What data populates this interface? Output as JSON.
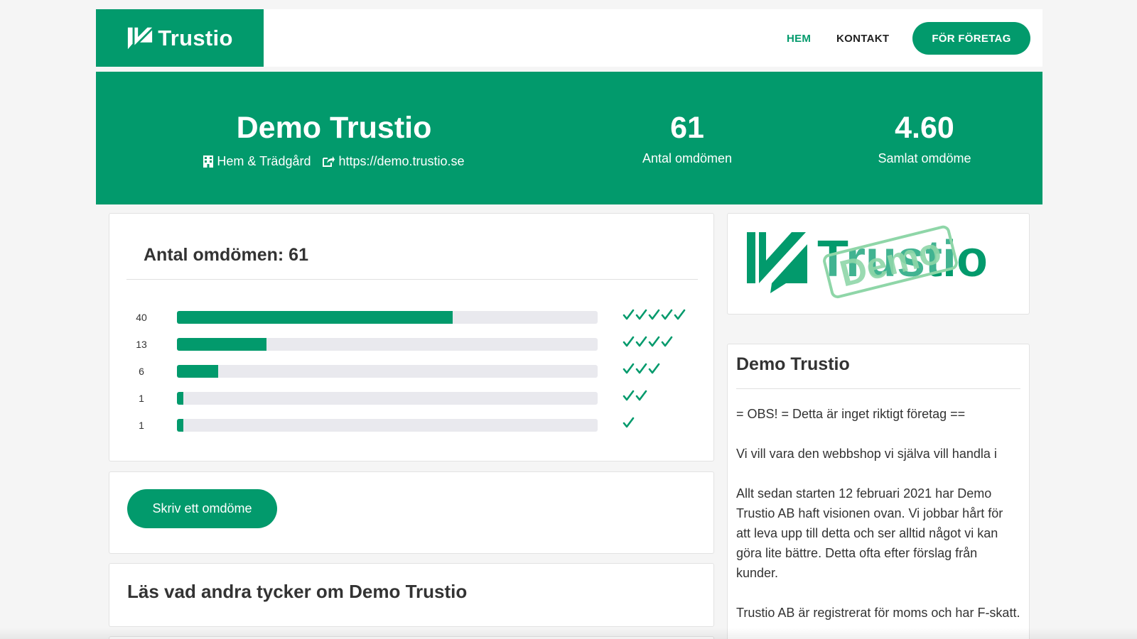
{
  "header": {
    "brand": "Trustio",
    "nav": {
      "home": "HEM",
      "contact": "KONTAKT",
      "business": "FÖR FÖRETAG"
    }
  },
  "hero": {
    "company": "Demo Trustio",
    "category": "Hem & Trädgård",
    "website": "https://demo.trustio.se",
    "review_count": "61",
    "review_count_label": "Antal omdömen",
    "score": "4.60",
    "score_label": "Samlat omdöme"
  },
  "summary": {
    "title": "Antal omdömen: 61",
    "rows": [
      {
        "count": "40",
        "checks": 5,
        "fill": 0.655
      },
      {
        "count": "13",
        "checks": 4,
        "fill": 0.212
      },
      {
        "count": "6",
        "checks": 3,
        "fill": 0.098
      },
      {
        "count": "1",
        "checks": 2,
        "fill": 0.016
      },
      {
        "count": "1",
        "checks": 1,
        "fill": 0.016
      }
    ]
  },
  "write_review": {
    "label": "Skriv ett omdöme"
  },
  "reviews": {
    "heading": "Läs vad andra tycker om Demo Trustio"
  },
  "logo_card": {
    "brand": "Trustio",
    "stamp": "Demo"
  },
  "about": {
    "title": "Demo Trustio",
    "paragraphs": [
      "= OBS! = Detta är inget riktigt företag ==",
      "Vi vill vara den webbshop vi själva vill handla i",
      "Allt sedan starten 12 februari 2021 har Demo Trustio AB haft visionen ovan. Vi jobbar hårt för att leva upp till detta och ser alltid något vi kan göra lite bättre. Detta ofta efter förslag från kunder.",
      "Trustio AB är registrerat för moms och har F-skatt."
    ]
  },
  "colors": {
    "brand": "#029a6c",
    "track": "#e9e9ee"
  }
}
